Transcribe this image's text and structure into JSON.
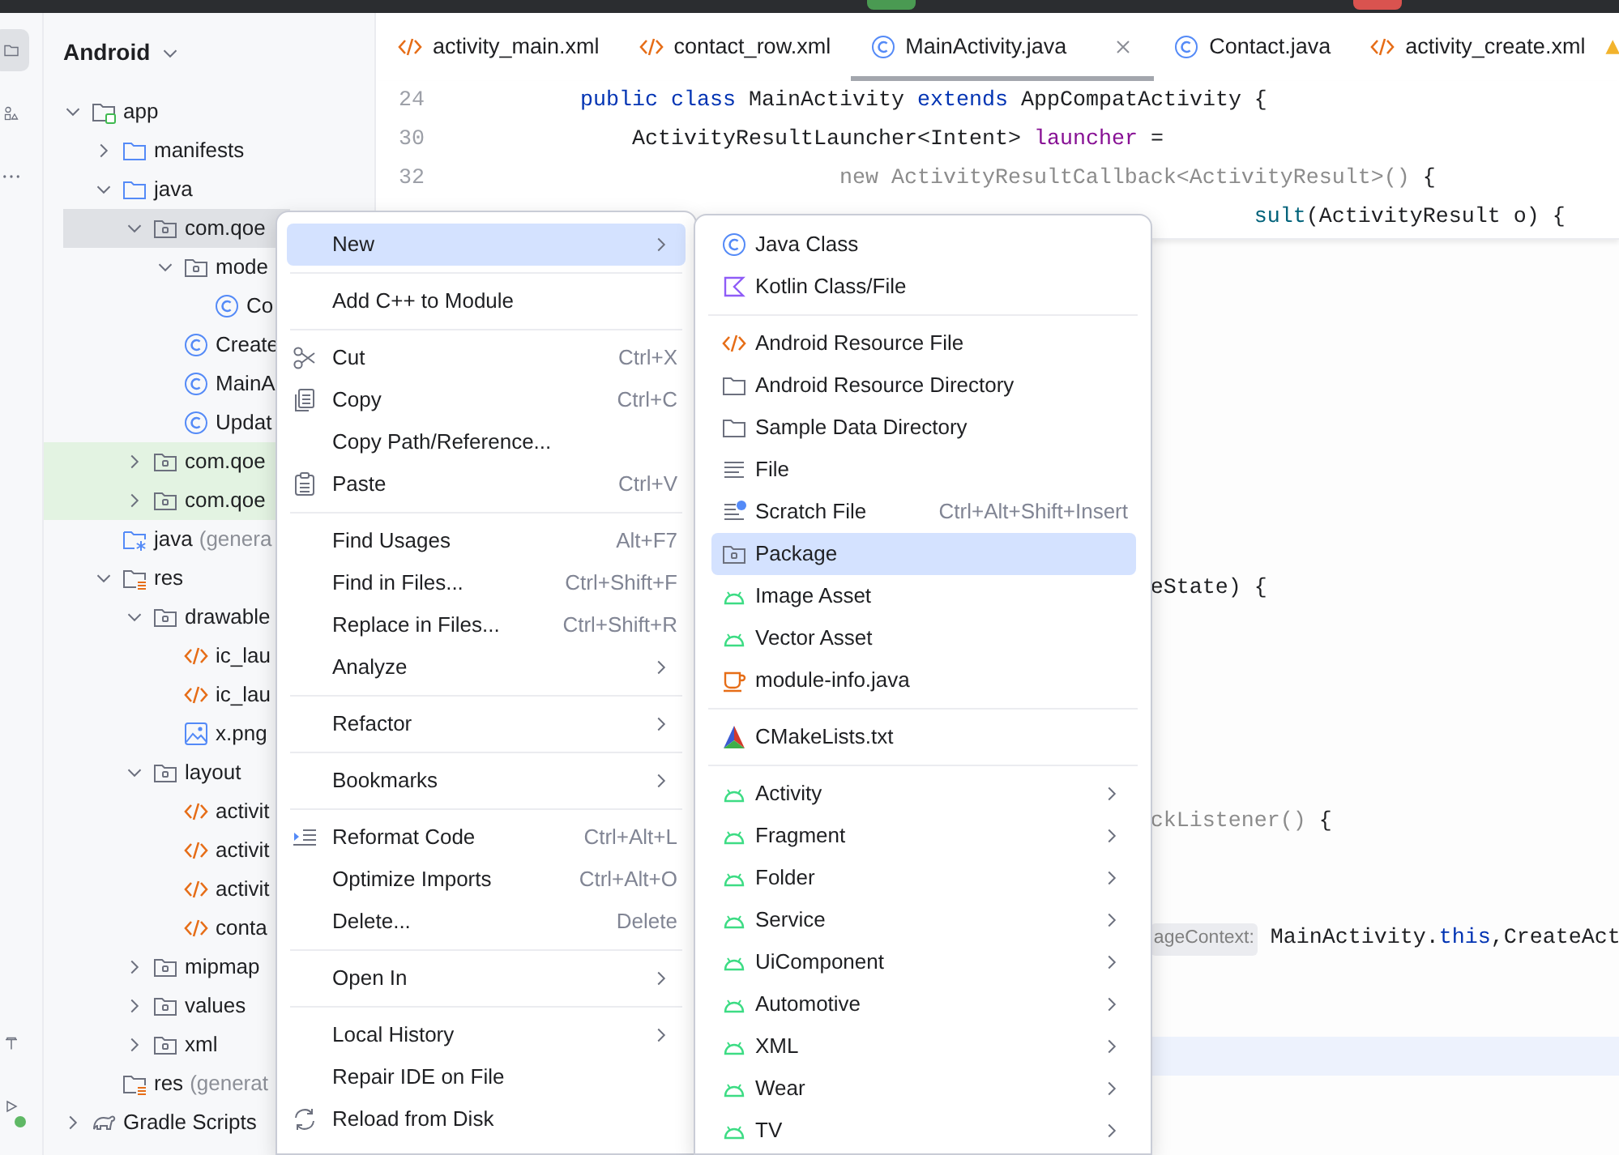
{
  "window_controls": [
    {
      "color": "#4a9a52"
    },
    {
      "color": "#d9534f"
    }
  ],
  "tool_windows": [
    {
      "kind": "project",
      "selected": true
    },
    {
      "kind": "structure",
      "selected": false
    },
    {
      "kind": "more",
      "selected": false
    }
  ],
  "tool_windows_bottom": [
    {
      "kind": "build",
      "selected": false,
      "notified": false
    },
    {
      "kind": "run",
      "selected": false,
      "notified": true
    }
  ],
  "project_panel": {
    "view": "Android",
    "tree": [
      {
        "label": "app",
        "kind": "module",
        "expanded": true,
        "selected": false,
        "highlighted": false,
        "children": [
          {
            "label": "manifests",
            "kind": "folder",
            "expanded": false,
            "selected": false,
            "highlighted": false
          },
          {
            "label": "java",
            "kind": "folder",
            "expanded": true,
            "selected": false,
            "highlighted": false,
            "children": [
              {
                "label": "com.qoe",
                "kind": "package",
                "expanded": true,
                "selected": true,
                "highlighted": false,
                "children": [
                  {
                    "label": "mode",
                    "kind": "package",
                    "expanded": true,
                    "selected": false,
                    "highlighted": false,
                    "children": [
                      {
                        "label": "Co",
                        "kind": "class",
                        "selected": false,
                        "highlighted": false
                      }
                    ]
                  },
                  {
                    "label": "Create",
                    "kind": "class",
                    "selected": false,
                    "highlighted": false
                  },
                  {
                    "label": "MainA",
                    "kind": "class",
                    "selected": false,
                    "highlighted": false
                  },
                  {
                    "label": "Updat",
                    "kind": "class",
                    "selected": false,
                    "highlighted": false
                  }
                ]
              },
              {
                "label": "com.qoe",
                "kind": "package",
                "expanded": false,
                "selected": false,
                "highlighted": true
              },
              {
                "label": "com.qoe",
                "kind": "package",
                "expanded": false,
                "selected": false,
                "highlighted": true
              }
            ]
          },
          {
            "label": "java",
            "note": "(genera",
            "kind": "generated",
            "selected": false,
            "highlighted": false
          },
          {
            "label": "res",
            "kind": "res",
            "expanded": true,
            "selected": false,
            "highlighted": false,
            "children": [
              {
                "label": "drawable",
                "kind": "package",
                "expanded": true,
                "selected": false,
                "highlighted": false,
                "children": [
                  {
                    "label": "ic_lau",
                    "kind": "xml",
                    "selected": false,
                    "highlighted": false
                  },
                  {
                    "label": "ic_lau",
                    "kind": "xml",
                    "selected": false,
                    "highlighted": false
                  },
                  {
                    "label": "x.png",
                    "kind": "image",
                    "selected": false,
                    "highlighted": false
                  }
                ]
              },
              {
                "label": "layout",
                "kind": "package",
                "expanded": true,
                "selected": false,
                "highlighted": false,
                "children": [
                  {
                    "label": "activit",
                    "kind": "xml",
                    "selected": false,
                    "highlighted": false
                  },
                  {
                    "label": "activit",
                    "kind": "xml",
                    "selected": false,
                    "highlighted": false
                  },
                  {
                    "label": "activit",
                    "kind": "xml",
                    "selected": false,
                    "highlighted": false
                  },
                  {
                    "label": "conta",
                    "kind": "xml",
                    "selected": false,
                    "highlighted": false
                  }
                ]
              },
              {
                "label": "mipmap",
                "kind": "package",
                "expanded": false,
                "selected": false,
                "highlighted": false
              },
              {
                "label": "values",
                "kind": "package",
                "expanded": false,
                "selected": false,
                "highlighted": false
              },
              {
                "label": "xml",
                "kind": "package",
                "expanded": false,
                "selected": false,
                "highlighted": false
              }
            ]
          },
          {
            "label": "res",
            "note": "(generat",
            "kind": "res",
            "selected": false,
            "highlighted": false
          }
        ]
      },
      {
        "label": "Gradle Scripts",
        "kind": "gradle",
        "expanded": false,
        "selected": false,
        "highlighted": false
      }
    ]
  },
  "tabs": [
    {
      "label": "activity_main.xml",
      "kind": "xml",
      "selected": false
    },
    {
      "label": "contact_row.xml",
      "kind": "xml",
      "selected": false
    },
    {
      "label": "MainActivity.java",
      "kind": "class",
      "selected": true
    },
    {
      "label": "Contact.java",
      "kind": "class",
      "selected": false
    },
    {
      "label": "activity_create.xml",
      "kind": "xml",
      "selected": false
    }
  ],
  "editor": {
    "sticky_lines": [
      {
        "number": "24",
        "segments": [
          {
            "kind": "keyword",
            "text": "    public class "
          },
          {
            "kind": "plain",
            "text": "MainActivity "
          },
          {
            "kind": "keyword",
            "text": "extends "
          },
          {
            "kind": "plain",
            "text": "AppCompatActivity {"
          }
        ]
      },
      {
        "number": "30",
        "segments": [
          {
            "kind": "plain",
            "text": "        ActivityResultLauncher<Intent> "
          },
          {
            "kind": "field",
            "text": "launcher"
          },
          {
            "kind": "plain",
            "text": " ="
          }
        ]
      },
      {
        "number": "32",
        "segments": [
          {
            "kind": "muted",
            "text": "                        new ActivityResultCallback<ActivityResult>()"
          },
          {
            "kind": "plain",
            "text": " {"
          }
        ]
      },
      {
        "segments": [
          {
            "kind": "method",
            "text": "                                                        sult"
          },
          {
            "kind": "plain",
            "text": "(ActivityResult o) {"
          }
        ]
      }
    ],
    "lines": [
      {
        "current": false
      },
      {
        "current": false
      },
      {
        "current": false
      },
      {
        "current": false
      },
      {
        "current": false
      },
      {
        "current": false
      },
      {
        "current": false
      },
      {
        "current": false
      },
      {
        "current": false,
        "segments": [
          {
            "kind": "plain",
            "text": "                                                eState) {"
          }
        ]
      },
      {
        "current": false
      },
      {
        "current": false
      },
      {
        "current": false
      },
      {
        "current": false
      },
      {
        "current": false
      },
      {
        "current": false,
        "segments": [
          {
            "kind": "muted",
            "text": "                                                ckListener()"
          },
          {
            "kind": "plain",
            "text": " {"
          }
        ]
      },
      {
        "current": false
      },
      {
        "current": false
      },
      {
        "current": false,
        "segments": [
          {
            "kind": "hint",
            "text": "                                                ageContext:"
          },
          {
            "kind": "plain",
            "text": " MainActivity."
          },
          {
            "kind": "keyword",
            "text": "this"
          },
          {
            "kind": "plain",
            "text": ",CreateAct"
          }
        ]
      },
      {
        "current": false
      },
      {
        "current": false
      },
      {
        "current": true
      }
    ]
  },
  "context_menu": {
    "sections": [
      [
        {
          "label": "New",
          "kind": "plain",
          "selected": true,
          "submenu": true
        }
      ],
      [
        {
          "label": "Add C++ to Module",
          "kind": "plain",
          "selected": false,
          "submenu": false
        }
      ],
      [
        {
          "label": "Cut",
          "kind": "scissors",
          "shortcut": "Ctrl+X",
          "selected": false,
          "submenu": false
        },
        {
          "label": "Copy",
          "kind": "copy",
          "shortcut": "Ctrl+C",
          "selected": false,
          "submenu": false
        },
        {
          "label": "Copy Path/Reference...",
          "kind": "plain",
          "selected": false,
          "submenu": false
        },
        {
          "label": "Paste",
          "kind": "paste",
          "shortcut": "Ctrl+V",
          "selected": false,
          "submenu": false
        }
      ],
      [
        {
          "label": "Find Usages",
          "kind": "plain",
          "shortcut": "Alt+F7",
          "selected": false,
          "submenu": false
        },
        {
          "label": "Find in Files...",
          "kind": "plain",
          "shortcut": "Ctrl+Shift+F",
          "selected": false,
          "submenu": false
        },
        {
          "label": "Replace in Files...",
          "kind": "plain",
          "shortcut": "Ctrl+Shift+R",
          "selected": false,
          "submenu": false
        },
        {
          "label": "Analyze",
          "kind": "plain",
          "selected": false,
          "submenu": true
        }
      ],
      [
        {
          "label": "Refactor",
          "kind": "plain",
          "selected": false,
          "submenu": true
        }
      ],
      [
        {
          "label": "Bookmarks",
          "kind": "plain",
          "selected": false,
          "submenu": true
        }
      ],
      [
        {
          "label": "Reformat Code",
          "kind": "reformat",
          "shortcut": "Ctrl+Alt+L",
          "selected": false,
          "submenu": false
        },
        {
          "label": "Optimize Imports",
          "kind": "plain",
          "shortcut": "Ctrl+Alt+O",
          "selected": false,
          "submenu": false
        },
        {
          "label": "Delete...",
          "kind": "plain",
          "shortcut": "Delete",
          "selected": false,
          "submenu": false
        }
      ],
      [
        {
          "label": "Open In",
          "kind": "plain",
          "selected": false,
          "submenu": true
        }
      ],
      [
        {
          "label": "Local History",
          "kind": "plain",
          "selected": false,
          "submenu": true
        },
        {
          "label": "Repair IDE on File",
          "kind": "plain",
          "selected": false,
          "submenu": false
        },
        {
          "label": "Reload from Disk",
          "kind": "reload",
          "selected": false,
          "submenu": false
        }
      ]
    ]
  },
  "new_submenu": {
    "sections": [
      [
        {
          "label": "Java Class",
          "kind": "class",
          "selected": false,
          "submenu": false
        },
        {
          "label": "Kotlin Class/File",
          "kind": "kotlin",
          "selected": false,
          "submenu": false
        }
      ],
      [
        {
          "label": "Android Resource File",
          "kind": "xml",
          "selected": false,
          "submenu": false
        },
        {
          "label": "Android Resource Directory",
          "kind": "directory",
          "selected": false,
          "submenu": false
        },
        {
          "label": "Sample Data Directory",
          "kind": "directory",
          "selected": false,
          "submenu": false
        },
        {
          "label": "File",
          "kind": "file",
          "selected": false,
          "submenu": false
        },
        {
          "label": "Scratch File",
          "kind": "scratch",
          "shortcut": "Ctrl+Alt+Shift+Insert",
          "selected": false,
          "submenu": false
        },
        {
          "label": "Package",
          "kind": "package",
          "selected": true,
          "submenu": false
        },
        {
          "label": "Image Asset",
          "kind": "android",
          "selected": false,
          "submenu": false
        },
        {
          "label": "Vector Asset",
          "kind": "android",
          "selected": false,
          "submenu": false
        },
        {
          "label": "module-info.java",
          "kind": "java",
          "selected": false,
          "submenu": false
        }
      ],
      [
        {
          "label": "CMakeLists.txt",
          "kind": "cmake",
          "selected": false,
          "submenu": false
        }
      ],
      [
        {
          "label": "Activity",
          "kind": "android",
          "selected": false,
          "submenu": true
        },
        {
          "label": "Fragment",
          "kind": "android",
          "selected": false,
          "submenu": true
        },
        {
          "label": "Folder",
          "kind": "android",
          "selected": false,
          "submenu": true
        },
        {
          "label": "Service",
          "kind": "android",
          "selected": false,
          "submenu": true
        },
        {
          "label": "UiComponent",
          "kind": "android",
          "selected": false,
          "submenu": true
        },
        {
          "label": "Automotive",
          "kind": "android",
          "selected": false,
          "submenu": true
        },
        {
          "label": "XML",
          "kind": "android",
          "selected": false,
          "submenu": true
        },
        {
          "label": "Wear",
          "kind": "android",
          "selected": false,
          "submenu": true
        },
        {
          "label": "TV",
          "kind": "android",
          "selected": false,
          "submenu": true
        }
      ]
    ]
  }
}
